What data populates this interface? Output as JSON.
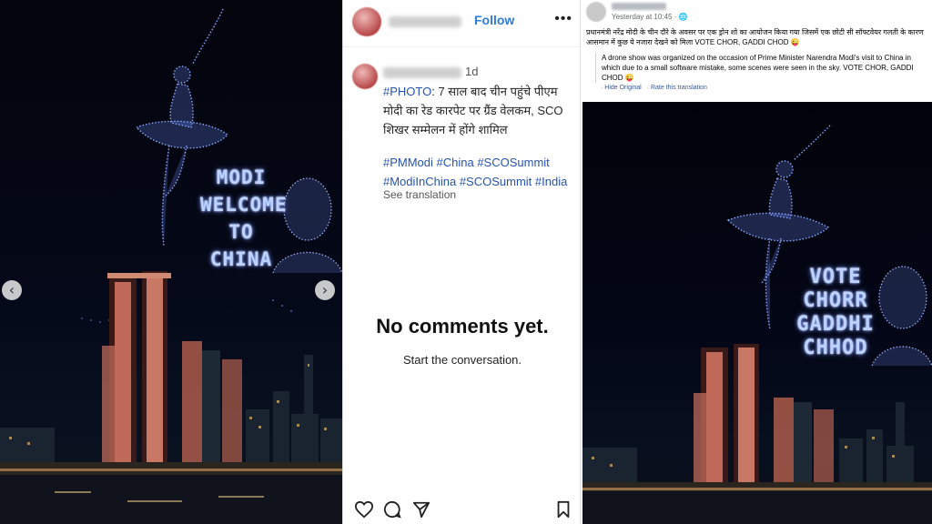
{
  "instagram": {
    "drone_text": {
      "line1": "MODI",
      "line2": "WELCOME",
      "line3": "TO",
      "line4": "CHINA"
    },
    "carousel": {
      "prev_icon": "chevron-left-icon",
      "next_icon": "chevron-right-icon"
    },
    "follow_label": "Follow",
    "more_icon": "more-dots-icon",
    "time_ago": "1d",
    "caption": {
      "tag": "#PHOTO",
      "text": ": 7 साल बाद चीन पहुंचे पीएम मोदी का रेड कारपेट पर ग्रैंड वेलकम, SCO शिखर सम्मेलन में होंगे शामिल"
    },
    "hashtags_line1": "#PMModi #China  #SCOSummit",
    "hashtags_line2": "#ModiInChina #SCOSummit #India",
    "see_translation": "See translation",
    "no_comments": "No comments yet.",
    "start_conversation": "Start the conversation.",
    "actions": [
      "heart-icon",
      "comment-icon",
      "share-icon",
      "bookmark-icon"
    ]
  },
  "facebook": {
    "time": "Yesterday at 10:45 · ",
    "hindi_text": "प्रधानमंत्री नरेंद्र मोदी के चीन दौरे के अवसर पर एक ड्रोन शो का आयोजन किया गया जिसमें एक छोटी सी सॉफ्टवेयर गलती के कारण आसमान में कुछ ये नजारा देखने को मिला VOTE CHOR, GADDI CHOD 😜",
    "translation": "A drone show was organized on the occasion of Prime Minister Narendra Modi's visit to China in which due to a small software mistake, some scenes were seen in the sky. VOTE CHOR, GADDI CHOD 😜",
    "hide_original": "· Hide Original",
    "rate_translation": "· Rate this translation",
    "drone_text": {
      "line1": "VOTE",
      "line2": "CHORR",
      "line3": "GADDHI",
      "line4": "CHHOD"
    }
  }
}
